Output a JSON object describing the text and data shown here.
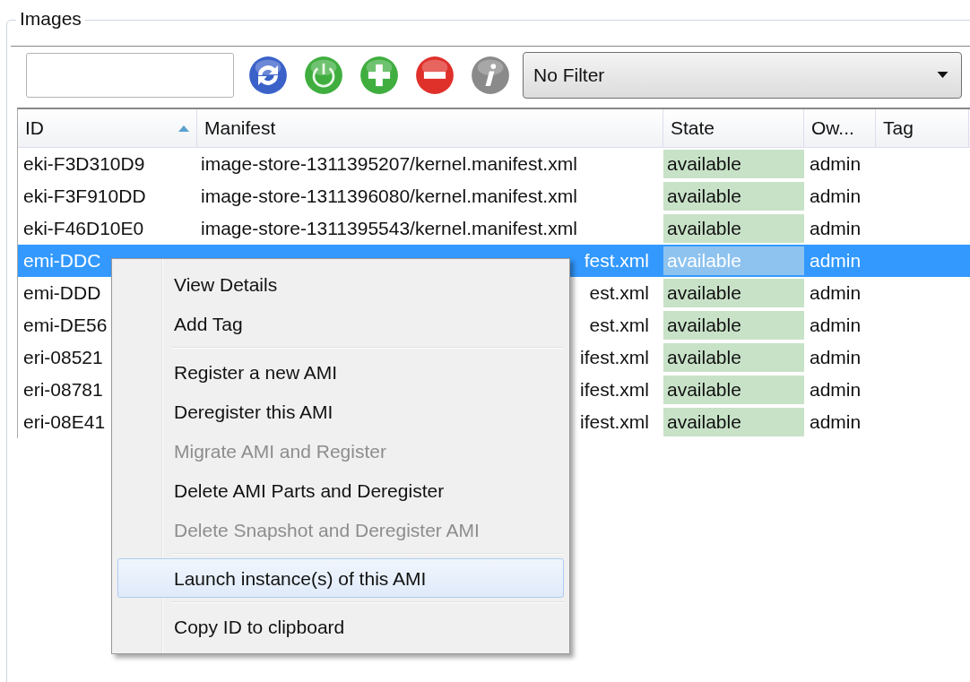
{
  "group_title": "Images",
  "toolbar": [
    {
      "kind": "refresh"
    },
    {
      "kind": "power"
    },
    {
      "kind": "add"
    },
    {
      "kind": "remove"
    },
    {
      "kind": "info"
    }
  ],
  "filter": {
    "value": "No Filter"
  },
  "table": {
    "columns": [
      {
        "label": "ID",
        "sorted": true
      },
      {
        "label": "Manifest",
        "sorted": false
      },
      {
        "label": "State",
        "sorted": false
      },
      {
        "label": "Ow...",
        "sorted": false
      },
      {
        "label": "Tag",
        "sorted": false
      }
    ],
    "rows": [
      {
        "id": "eki-F3D310D9",
        "manifest": "image-store-1311395207/kernel.manifest.xml",
        "state": "available",
        "owner": "admin",
        "selected": false,
        "covered": false
      },
      {
        "id": "eki-F3F910DD",
        "manifest": "image-store-1311396080/kernel.manifest.xml",
        "state": "available",
        "owner": "admin",
        "selected": false,
        "covered": false
      },
      {
        "id": "eki-F46D10E0",
        "manifest": "image-store-1311395543/kernel.manifest.xml",
        "state": "available",
        "owner": "admin",
        "selected": false,
        "covered": false
      },
      {
        "id": "emi-DDC",
        "manifest": "fest.xml",
        "state": "available",
        "owner": "admin",
        "selected": true,
        "covered": true
      },
      {
        "id": "emi-DDD",
        "manifest": "est.xml",
        "state": "available",
        "owner": "admin",
        "selected": false,
        "covered": true
      },
      {
        "id": "emi-DE56",
        "manifest": "est.xml",
        "state": "available",
        "owner": "admin",
        "selected": false,
        "covered": true
      },
      {
        "id": "eri-08521",
        "manifest": "ifest.xml",
        "state": "available",
        "owner": "admin",
        "selected": false,
        "covered": true
      },
      {
        "id": "eri-08781",
        "manifest": "ifest.xml",
        "state": "available",
        "owner": "admin",
        "selected": false,
        "covered": true
      },
      {
        "id": "eri-08E41",
        "manifest": "ifest.xml",
        "state": "available",
        "owner": "admin",
        "selected": false,
        "covered": true
      }
    ]
  },
  "context_menu": [
    {
      "kind": "item",
      "label": "View Details",
      "disabled": false,
      "selected": false
    },
    {
      "kind": "item",
      "label": "Add Tag",
      "disabled": false,
      "selected": false
    },
    {
      "kind": "separator"
    },
    {
      "kind": "item",
      "label": "Register a new AMI",
      "disabled": false,
      "selected": false
    },
    {
      "kind": "item",
      "label": "Deregister this AMI",
      "disabled": false,
      "selected": false
    },
    {
      "kind": "item",
      "label": "Migrate AMI and Register",
      "disabled": true,
      "selected": false
    },
    {
      "kind": "item",
      "label": "Delete AMI Parts and Deregister",
      "disabled": false,
      "selected": false
    },
    {
      "kind": "item",
      "label": "Delete Snapshot and Deregister AMI",
      "disabled": true,
      "selected": false
    },
    {
      "kind": "separator"
    },
    {
      "kind": "item",
      "label": "Launch instance(s) of this AMI",
      "disabled": false,
      "selected": true
    },
    {
      "kind": "separator"
    },
    {
      "kind": "item",
      "label": "Copy ID to clipboard",
      "disabled": false,
      "selected": false
    }
  ]
}
